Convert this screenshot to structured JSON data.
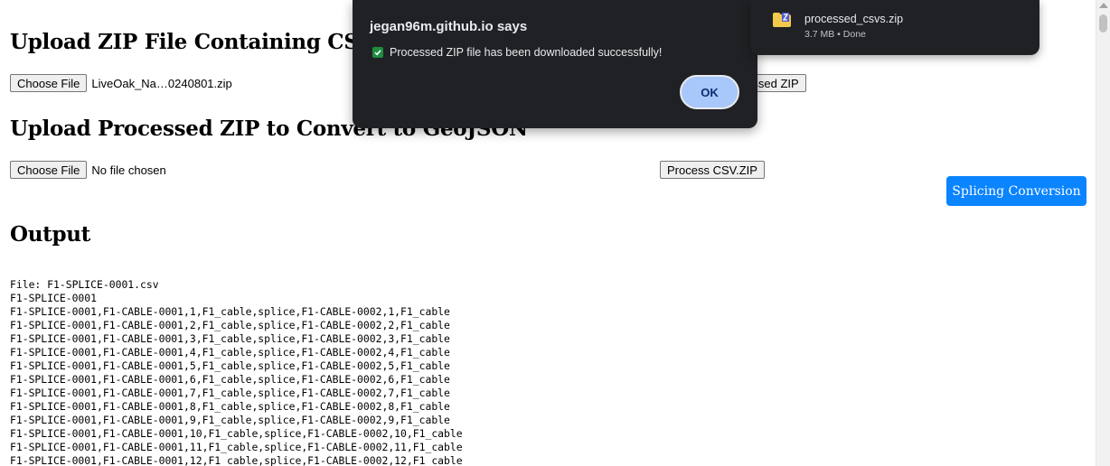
{
  "section1": {
    "heading": "Upload ZIP File Containing CSVs",
    "choose_label": "Choose File",
    "file_name": "LiveOak_Na…0240801.zip",
    "process_label": "Download Processed ZIP"
  },
  "section2": {
    "heading": "Upload Processed ZIP to Convert to GeoJSON",
    "choose_label": "Choose File",
    "file_name": "No file chosen",
    "process_label": "Process CSV.ZIP"
  },
  "splicing_button": "Splicing Conversion",
  "output": {
    "heading": "Output",
    "lines": [
      "File: F1-SPLICE-0001.csv",
      "F1-SPLICE-0001",
      "F1-SPLICE-0001,F1-CABLE-0001,1,F1_cable,splice,F1-CABLE-0002,1,F1_cable",
      "F1-SPLICE-0001,F1-CABLE-0001,2,F1_cable,splice,F1-CABLE-0002,2,F1_cable",
      "F1-SPLICE-0001,F1-CABLE-0001,3,F1_cable,splice,F1-CABLE-0002,3,F1_cable",
      "F1-SPLICE-0001,F1-CABLE-0001,4,F1_cable,splice,F1-CABLE-0002,4,F1_cable",
      "F1-SPLICE-0001,F1-CABLE-0001,5,F1_cable,splice,F1-CABLE-0002,5,F1_cable",
      "F1-SPLICE-0001,F1-CABLE-0001,6,F1_cable,splice,F1-CABLE-0002,6,F1_cable",
      "F1-SPLICE-0001,F1-CABLE-0001,7,F1_cable,splice,F1-CABLE-0002,7,F1_cable",
      "F1-SPLICE-0001,F1-CABLE-0001,8,F1_cable,splice,F1-CABLE-0002,8,F1_cable",
      "F1-SPLICE-0001,F1-CABLE-0001,9,F1_cable,splice,F1-CABLE-0002,9,F1_cable",
      "F1-SPLICE-0001,F1-CABLE-0001,10,F1_cable,splice,F1-CABLE-0002,10,F1_cable",
      "F1-SPLICE-0001,F1-CABLE-0001,11,F1_cable,splice,F1-CABLE-0002,11,F1_cable",
      "F1-SPLICE-0001,F1-CABLE-0001,12,F1_cable,splice,F1-CABLE-0002,12,F1_cable"
    ]
  },
  "dialog": {
    "title": "jegan96m.github.io says",
    "message": "Processed ZIP file has been downloaded successfully!",
    "ok_label": "OK"
  },
  "download": {
    "file_name": "processed_csvs.zip",
    "status": "3.7 MB • Done"
  },
  "colors": {
    "accent_button": "#0a84ff",
    "dialog_bg": "#202124",
    "ok_button": "#a8c7fa",
    "check_green": "#1e8e3e"
  },
  "icons": [
    "check-icon",
    "zip-file-icon",
    "scroll-up-arrow-icon"
  ]
}
